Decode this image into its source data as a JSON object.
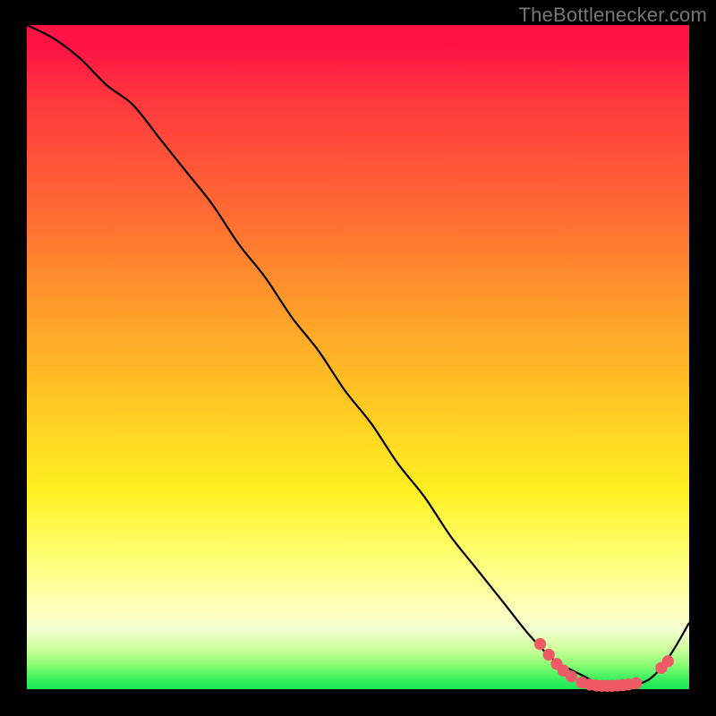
{
  "watermark": "TheBottlenecker.com",
  "chart_data": {
    "type": "line",
    "title": "",
    "xlabel": "",
    "ylabel": "",
    "xlim": [
      0,
      100
    ],
    "ylim": [
      0,
      100
    ],
    "grid": false,
    "legend": false,
    "series": [
      {
        "name": "curve",
        "x": [
          0,
          4,
          8,
          12,
          16,
          20,
          24,
          28,
          32,
          36,
          40,
          44,
          48,
          52,
          56,
          60,
          64,
          68,
          72,
          76,
          80,
          82,
          84,
          86,
          88,
          90,
          92,
          94,
          96,
          98,
          100
        ],
        "y": [
          100,
          98,
          95,
          91,
          88,
          83,
          78,
          73,
          67,
          62,
          56,
          51,
          45,
          40,
          34,
          29,
          23,
          18,
          13,
          8,
          4,
          3,
          2,
          1,
          0.5,
          0.5,
          0.7,
          1.5,
          3.5,
          6.5,
          10
        ]
      }
    ],
    "markers": [
      {
        "x": 77.5,
        "y": 6.8
      },
      {
        "x": 78.8,
        "y": 5.2
      },
      {
        "x": 80.0,
        "y": 3.8
      },
      {
        "x": 81.0,
        "y": 2.8
      },
      {
        "x": 82.2,
        "y": 1.9
      },
      {
        "x": 83.8,
        "y": 1.0
      },
      {
        "x": 85.0,
        "y": 0.7
      },
      {
        "x": 86.0,
        "y": 0.55
      },
      {
        "x": 86.8,
        "y": 0.5
      },
      {
        "x": 87.6,
        "y": 0.5
      },
      {
        "x": 88.4,
        "y": 0.5
      },
      {
        "x": 89.2,
        "y": 0.55
      },
      {
        "x": 90.0,
        "y": 0.6
      },
      {
        "x": 90.8,
        "y": 0.7
      },
      {
        "x": 92.0,
        "y": 0.9
      },
      {
        "x": 95.8,
        "y": 3.2
      },
      {
        "x": 96.8,
        "y": 4.2
      }
    ],
    "colors": {
      "curve": "#000000",
      "marker": "#ef5a66",
      "gradient_top": "#ff1345",
      "gradient_bottom": "#16e757"
    }
  }
}
